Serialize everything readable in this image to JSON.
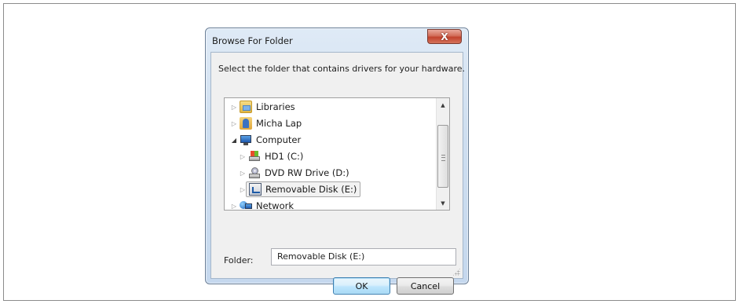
{
  "dialog": {
    "title": "Browse For Folder",
    "close_label": "X",
    "instruction": "Select the folder that contains drivers for your hardware."
  },
  "tree": {
    "items": [
      {
        "label": "Libraries",
        "icon": "libraries-icon",
        "expanded": false
      },
      {
        "label": "Micha Lap",
        "icon": "user-folder-icon",
        "expanded": false
      },
      {
        "label": "Computer",
        "icon": "computer-icon",
        "expanded": true
      },
      {
        "label": "HD1 (C:)",
        "icon": "hard-drive-icon",
        "expanded": false
      },
      {
        "label": "DVD RW Drive (D:)",
        "icon": "dvd-drive-icon",
        "expanded": false
      },
      {
        "label": "Removable Disk (E:)",
        "icon": "removable-disk-icon",
        "expanded": false,
        "selected": true
      },
      {
        "label": "Network",
        "icon": "network-icon",
        "expanded": false
      }
    ]
  },
  "folder": {
    "label": "Folder:",
    "value": "Removable Disk (E:)"
  },
  "buttons": {
    "ok": "OK",
    "cancel": "Cancel"
  },
  "scrollbar": {
    "up_glyph": "▲",
    "down_glyph": "▼"
  }
}
